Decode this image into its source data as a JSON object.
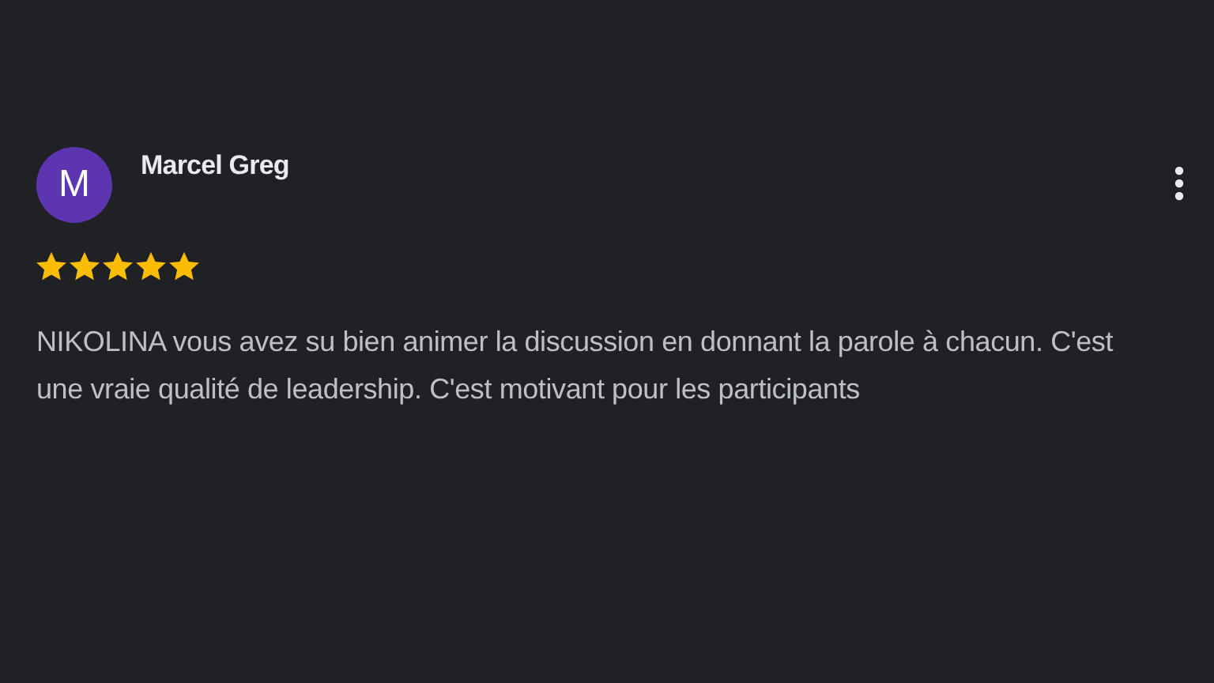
{
  "review": {
    "avatar_letter": "M",
    "author": "Marcel Greg",
    "stars": 5,
    "text": "NIKOLINA vous avez su bien animer la discussion en donnant la parole à chacun. C'est une vraie qualité de leadership. C'est motivant pour les participants"
  }
}
